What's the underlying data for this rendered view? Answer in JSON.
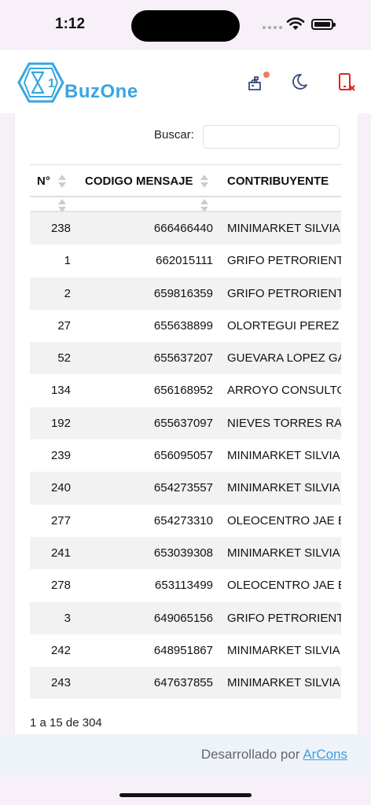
{
  "status": {
    "time": "1:12"
  },
  "header": {
    "brand": "BuzOne",
    "logo_digit": "1",
    "icons": [
      "mailbox-icon",
      "moon-icon",
      "device-close-icon"
    ],
    "accent": "#37a6e0",
    "alert_color": "#e02020"
  },
  "search": {
    "label": "Buscar:",
    "value": "",
    "placeholder": ""
  },
  "table": {
    "columns": [
      "N°",
      "CODIGO MENSAJE",
      "CONTRIBUYENTE"
    ],
    "rows": [
      {
        "num": "238",
        "code": "666466440",
        "name": "MINIMARKET SILVIA E"
      },
      {
        "num": "1",
        "code": "662015111",
        "name": "GRIFO PETRORIENTE"
      },
      {
        "num": "2",
        "code": "659816359",
        "name": "GRIFO PETRORIENTE"
      },
      {
        "num": "27",
        "code": "655638899",
        "name": "OLORTEGUI PEREZ F"
      },
      {
        "num": "52",
        "code": "655637207",
        "name": "GUEVARA LOPEZ GA"
      },
      {
        "num": "134",
        "code": "656168952",
        "name": "ARROYO CONSULTO"
      },
      {
        "num": "192",
        "code": "655637097",
        "name": "NIEVES TORRES RAU"
      },
      {
        "num": "239",
        "code": "656095057",
        "name": "MINIMARKET SILVIA E"
      },
      {
        "num": "240",
        "code": "654273557",
        "name": "MINIMARKET SILVIA E"
      },
      {
        "num": "277",
        "code": "654273310",
        "name": "OLEOCENTRO JAE E"
      },
      {
        "num": "241",
        "code": "653039308",
        "name": "MINIMARKET SILVIA E"
      },
      {
        "num": "278",
        "code": "653113499",
        "name": "OLEOCENTRO JAE E"
      },
      {
        "num": "3",
        "code": "649065156",
        "name": "GRIFO PETRORIENTE"
      },
      {
        "num": "242",
        "code": "648951867",
        "name": "MINIMARKET SILVIA E"
      },
      {
        "num": "243",
        "code": "647637855",
        "name": "MINIMARKET SILVIA E"
      }
    ]
  },
  "pager": {
    "info": "1 a 15 de 304"
  },
  "footer": {
    "text": "Desarrollado por",
    "link": "ArCons"
  }
}
